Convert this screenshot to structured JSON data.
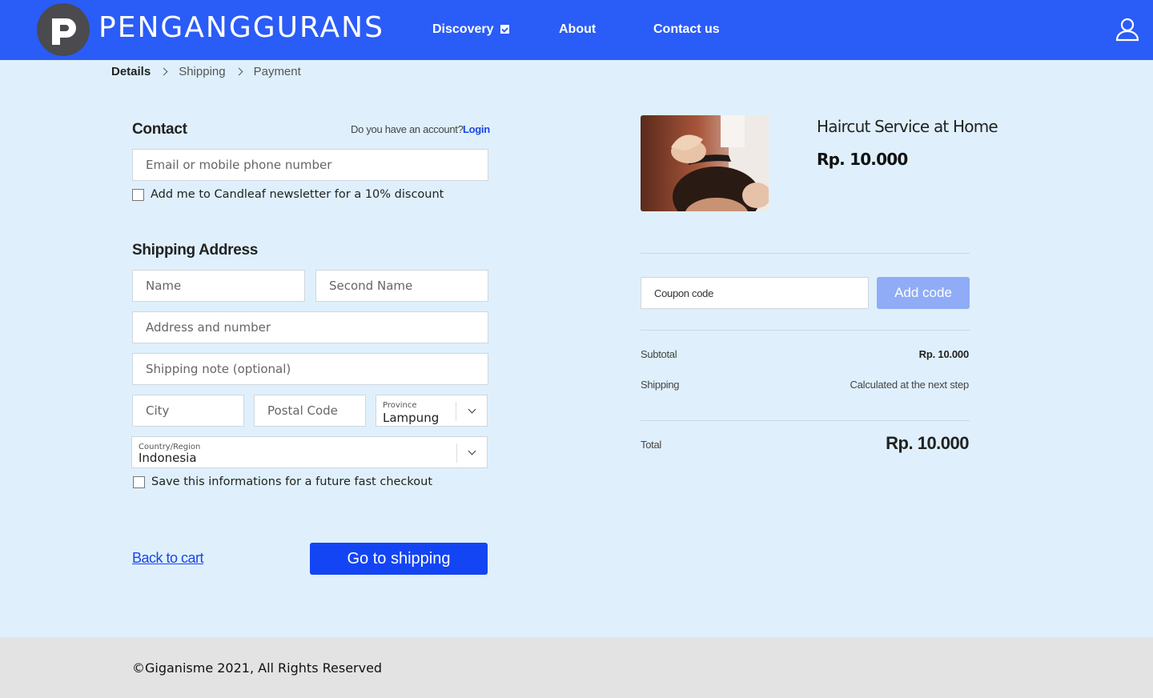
{
  "header": {
    "brand": "PENGANGGURANS",
    "nav": {
      "discovery": "Discovery",
      "about": "About",
      "contact": "Contact us"
    },
    "colors": {
      "bar": "#2a5cf7"
    }
  },
  "breadcrumb": {
    "details": "Details",
    "shipping": "Shipping",
    "payment": "Payment"
  },
  "contact": {
    "title": "Contact",
    "account_question": "Do you have an account?",
    "login": "Login",
    "email_placeholder": "Email or mobile phone number",
    "newsletter_label": "Add me to Candleaf newsletter for a 10% discount"
  },
  "shipping_address": {
    "title": "Shipping Address",
    "name_placeholder": "Name",
    "second_name_placeholder": "Second Name",
    "address_placeholder": "Address and number",
    "note_placeholder": "Shipping note (optional)",
    "city_placeholder": "City",
    "postal_placeholder": "Postal Code",
    "province_label": "Province",
    "province_value": "Lampung",
    "country_label": "Country/Region",
    "country_value": "Indonesia",
    "save_label": "Save this informations for a future fast checkout"
  },
  "actions": {
    "back": "Back to cart",
    "next": "Go to shipping"
  },
  "order": {
    "product_name": "Haircut Service at Home",
    "product_price": "Rp. 10.000",
    "coupon_placeholder": "Coupon code",
    "add_code": "Add code",
    "subtotal_label": "Subtotal",
    "subtotal_value": "Rp. 10.000",
    "shipping_label": "Shipping",
    "shipping_value": "Calculated at the next step",
    "total_label": "Total",
    "total_value": "Rp. 10.000"
  },
  "footer": {
    "copyright": "©Giganisme 2021, All Rights Reserved"
  }
}
